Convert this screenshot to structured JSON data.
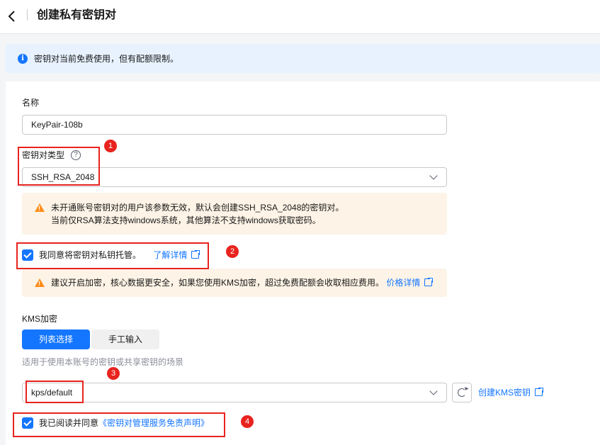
{
  "header": {
    "title": "创建私有密钥对"
  },
  "info": {
    "text": "密钥对当前免费使用，但有配额限制。"
  },
  "form": {
    "name_label": "名称",
    "name_value": "KeyPair-108b",
    "type_label": "密钥对类型",
    "type_value": "SSH_RSA_2048",
    "type_warning_line1": "未开通账号密钥对的用户该参数无效，默认会创建SSH_RSA_2048的密钥对。",
    "type_warning_line2": "当前仅RSA算法支持windows系统，其他算法不支持windows获取密码。",
    "host_agree_text": "我同意将密钥对私钥托管。",
    "host_learn_more": "了解详情",
    "encrypt_warning_text": "建议开启加密，核心数据更安全，如果您使用KMS加密，超过免费配额会收取相应费用。",
    "encrypt_price_link": "价格详情",
    "kms_label": "KMS加密",
    "kms_tab_list": "列表选择",
    "kms_tab_manual": "手工输入",
    "kms_hint": "适用于使用本账号的密钥或共享密钥的场景",
    "kms_value": "kps/default",
    "kms_create_link": "创建KMS密钥",
    "agree_prefix": "我已阅读并同意",
    "agree_link": "《密钥对管理服务免责声明》"
  },
  "annotations": {
    "b1": "1",
    "b2": "2",
    "b3": "3",
    "b4": "4"
  },
  "colors": {
    "primary": "#1476ff",
    "warning_bg": "#fdf3e6",
    "annotation_red": "#e8231e",
    "info_bg": "#e8f2ff"
  }
}
